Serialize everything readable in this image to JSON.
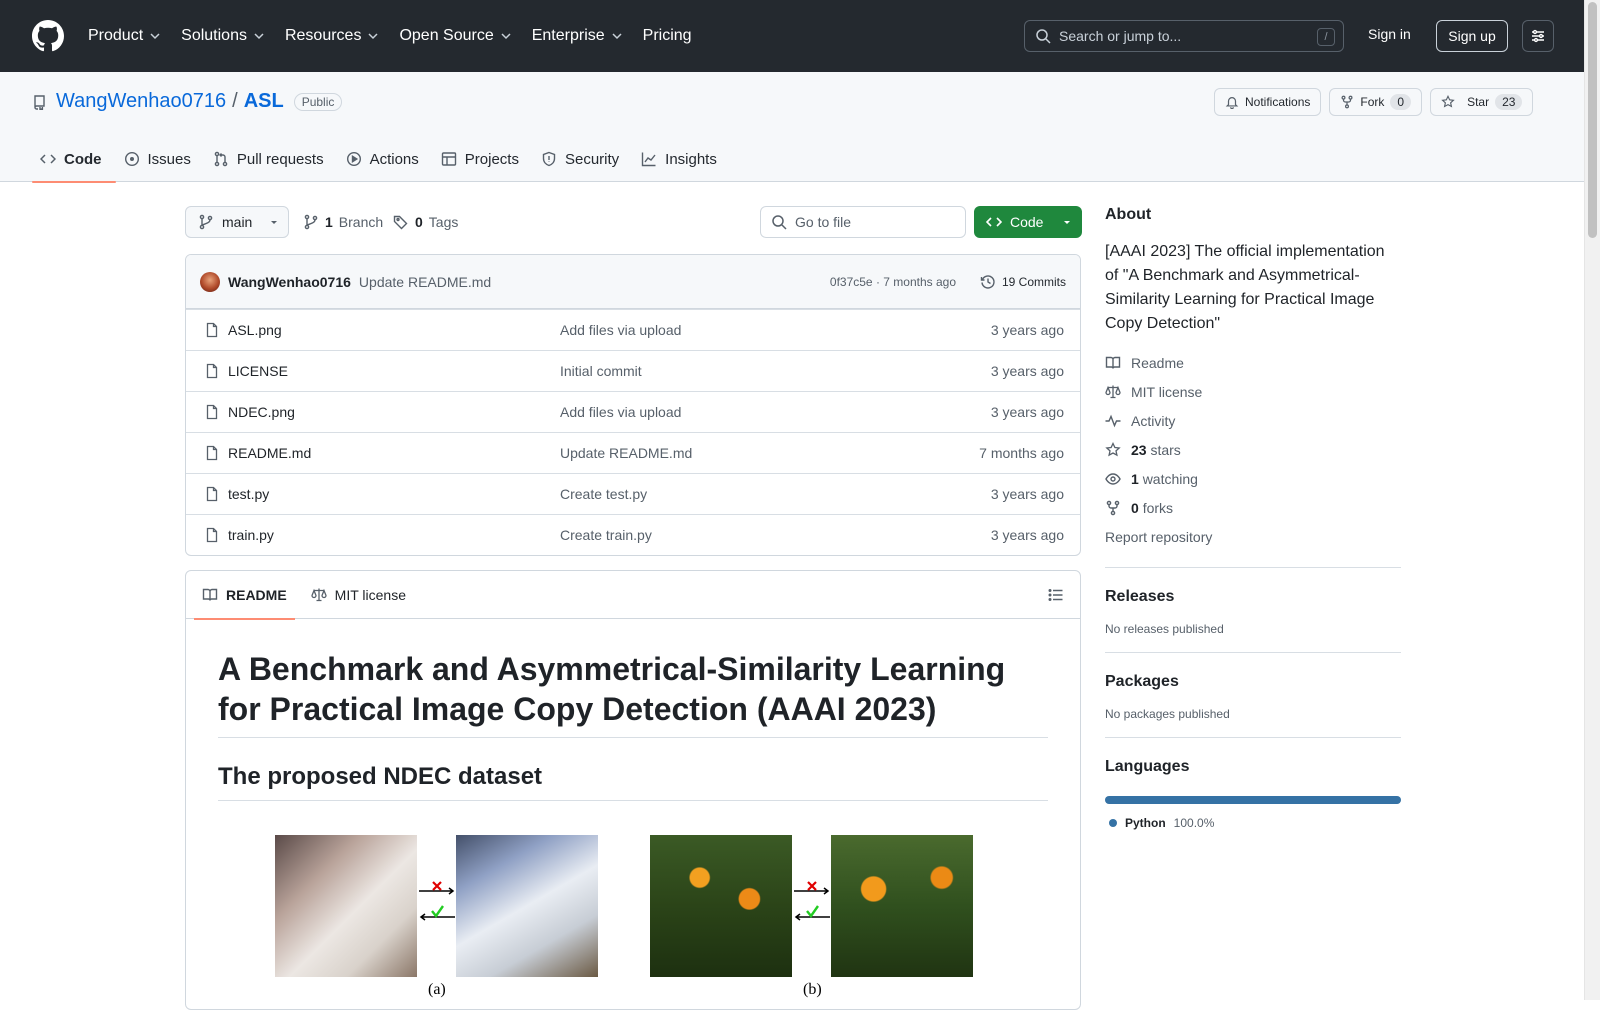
{
  "header": {
    "nav": [
      {
        "label": "Product",
        "caret": true
      },
      {
        "label": "Solutions",
        "caret": true
      },
      {
        "label": "Resources",
        "caret": true
      },
      {
        "label": "Open Source",
        "caret": true
      },
      {
        "label": "Enterprise",
        "caret": true
      },
      {
        "label": "Pricing",
        "caret": false
      }
    ],
    "search_placeholder": "Search or jump to...",
    "search_key": "/",
    "signin": "Sign in",
    "signup": "Sign up"
  },
  "repo": {
    "owner": "WangWenhao0716",
    "separator": "/",
    "name": "ASL",
    "visibility": "Public",
    "notifications_label": "Notifications",
    "fork_label": "Fork",
    "fork_count": "0",
    "star_label": "Star",
    "star_count": "23"
  },
  "tabs": [
    {
      "label": "Code",
      "icon": "code-icon",
      "active": true
    },
    {
      "label": "Issues",
      "icon": "issue-icon",
      "active": false
    },
    {
      "label": "Pull requests",
      "icon": "pull-request-icon",
      "active": false
    },
    {
      "label": "Actions",
      "icon": "play-icon",
      "active": false
    },
    {
      "label": "Projects",
      "icon": "table-icon",
      "active": false
    },
    {
      "label": "Security",
      "icon": "shield-icon",
      "active": false
    },
    {
      "label": "Insights",
      "icon": "graph-icon",
      "active": false
    }
  ],
  "toolbar": {
    "branch": "main",
    "branch_count": "1",
    "branch_label": "Branch",
    "tag_count": "0",
    "tag_label": "Tags",
    "goto_placeholder": "Go to file",
    "code_label": "Code"
  },
  "commit": {
    "author": "WangWenhao0716",
    "message": "Update README.md",
    "meta": "0f37c5e · 7 months ago",
    "count_label": "19 Commits"
  },
  "files": [
    {
      "name": "ASL.png",
      "message": "Add files via upload",
      "date": "3 years ago"
    },
    {
      "name": "LICENSE",
      "message": "Initial commit",
      "date": "3 years ago"
    },
    {
      "name": "NDEC.png",
      "message": "Add files via upload",
      "date": "3 years ago"
    },
    {
      "name": "README.md",
      "message": "Update README.md",
      "date": "7 months ago"
    },
    {
      "name": "test.py",
      "message": "Create test.py",
      "date": "3 years ago"
    },
    {
      "name": "train.py",
      "message": "Create train.py",
      "date": "3 years ago"
    }
  ],
  "readme": {
    "tab_readme": "README",
    "tab_license": "MIT license",
    "h1": "A Benchmark and Asymmetrical-Similarity Learning for Practical Image Copy Detection (AAAI 2023)",
    "h2": "The proposed NDEC dataset",
    "fig_label_a": "(a)",
    "fig_label_b": "(b)"
  },
  "sidebar": {
    "about_title": "About",
    "description": "[AAAI 2023] The official implementation of \"A Benchmark and Asymmetrical-Similarity Learning for Practical Image Copy Detection\"",
    "readme": "Readme",
    "license": "MIT license",
    "activity": "Activity",
    "stars_count": "23",
    "stars_label": "stars",
    "watching_count": "1",
    "watching_label": "watching",
    "forks_count": "0",
    "forks_label": "forks",
    "report": "Report repository",
    "releases_title": "Releases",
    "releases_text": "No releases published",
    "packages_title": "Packages",
    "packages_text": "No packages published",
    "languages_title": "Languages",
    "language_name": "Python",
    "language_pct": "100.0%",
    "language_color": "#3572A5"
  }
}
